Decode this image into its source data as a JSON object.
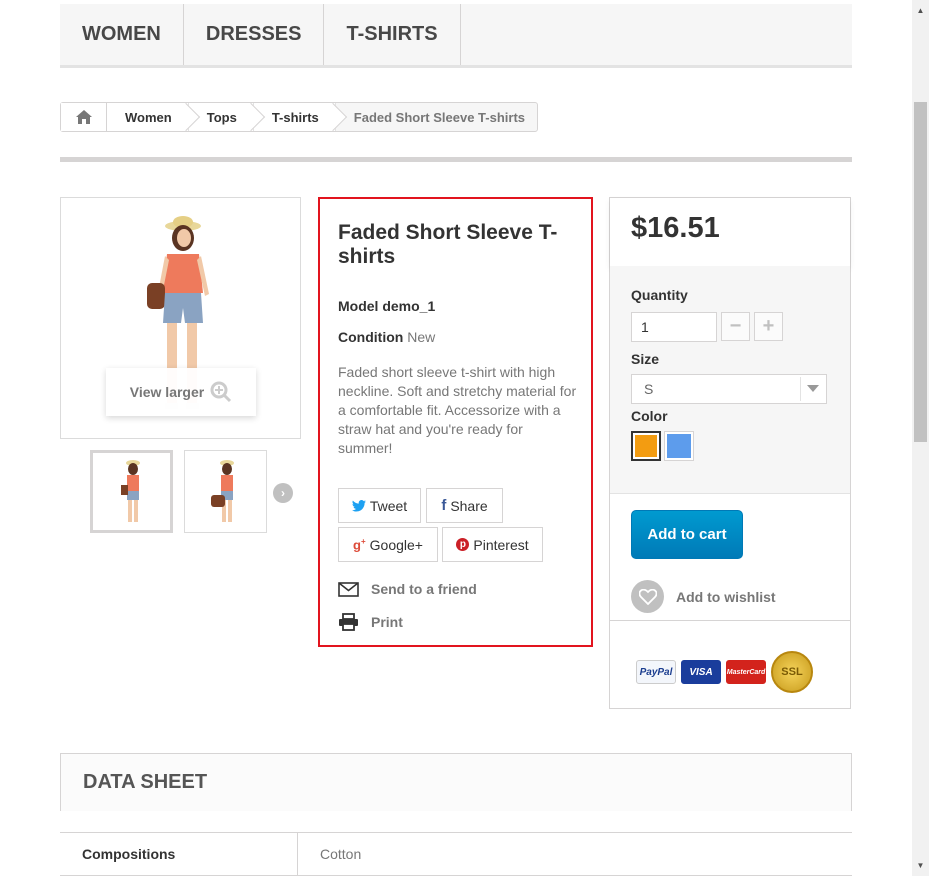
{
  "nav": {
    "items": [
      {
        "label": "WOMEN"
      },
      {
        "label": "DRESSES"
      },
      {
        "label": "T-SHIRTS"
      }
    ]
  },
  "breadcrumb": {
    "home_icon": "home-icon",
    "crumbs": [
      "Women",
      "Tops",
      "T-shirts"
    ],
    "current": "Faded Short Sleeve T-shirts"
  },
  "gallery": {
    "view_larger": "View larger",
    "zoom_icon": "zoom-in-icon",
    "next_icon": "chevron-right-icon"
  },
  "product": {
    "title": "Faded Short Sleeve T-shirts",
    "model_label": "Model",
    "model_value": "demo_1",
    "condition_label": "Condition",
    "condition_value": "New",
    "description": "Faded short sleeve t-shirt with high neckline. Soft and stretchy material for a comfortable fit. Accessorize with a straw hat and you're ready for summer!"
  },
  "social": {
    "tweet": "Tweet",
    "share": "Share",
    "google": "Google+",
    "pinterest": "Pinterest",
    "send_friend": "Send to a friend",
    "print": "Print"
  },
  "buy": {
    "price": "$16.51",
    "quantity_label": "Quantity",
    "quantity_value": "1",
    "size_label": "Size",
    "size_value": "S",
    "color_label": "Color",
    "colors": [
      "#f39c11",
      "#5d9cec"
    ],
    "add_to_cart": "Add to cart",
    "add_to_wishlist": "Add to wishlist",
    "payment_logos": [
      "PayPal",
      "VISA",
      "MasterCard",
      "SSL"
    ]
  },
  "datasheet": {
    "title": "DATA SHEET",
    "rows": [
      {
        "key": "Compositions",
        "value": "Cotton"
      }
    ]
  },
  "colors": {
    "accent": "#e2141e",
    "cart_button": "#009ad0"
  }
}
